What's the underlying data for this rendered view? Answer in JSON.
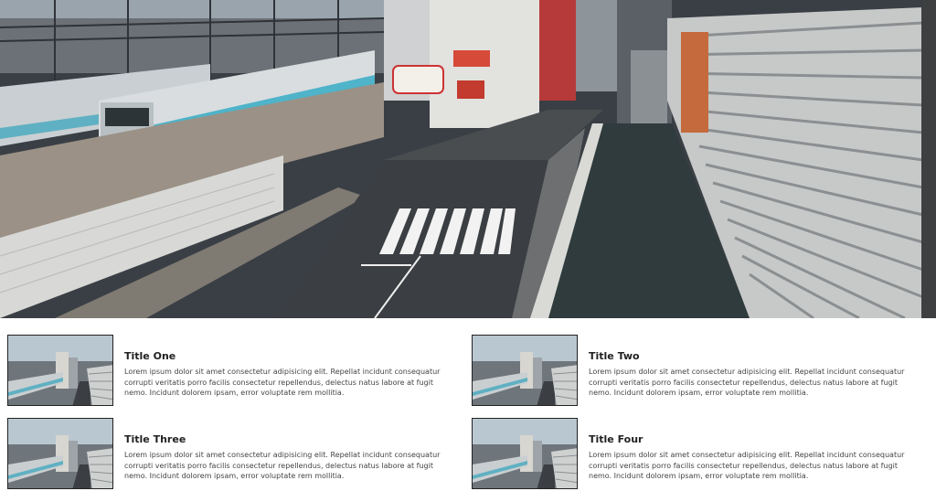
{
  "hero": {
    "image_icon": "city-street-photo"
  },
  "cards": [
    {
      "title": "Title One",
      "body": "Lorem ipsum dolor sit amet consectetur adipisicing elit. Repellat incidunt consequatur corrupti veritatis porro facilis consectetur repellendus, delectus natus labore at fugit nemo. Incidunt dolorem ipsam, error voluptate rem mollitia."
    },
    {
      "title": "Title Two",
      "body": "Lorem ipsum dolor sit amet consectetur adipisicing elit. Repellat incidunt consequatur corrupti veritatis porro facilis consectetur repellendus, delectus natus labore at fugit nemo. Incidunt dolorem ipsam, error voluptate rem mollitia."
    },
    {
      "title": "Title Three",
      "body": "Lorem ipsum dolor sit amet consectetur adipisicing elit. Repellat incidunt consequatur corrupti veritatis porro facilis consectetur repellendus, delectus natus labore at fugit nemo. Incidunt dolorem ipsam, error voluptate rem mollitia."
    },
    {
      "title": "Title Four",
      "body": "Lorem ipsum dolor sit amet consectetur adipisicing elit. Repellat incidunt consequatur corrupti veritatis porro facilis consectetur repellendus, delectus natus labore at fugit nemo. Incidunt dolorem ipsam, error voluptate rem mollitia."
    }
  ],
  "colors": {
    "title": "#222222",
    "body": "#444444",
    "thumb_border": "#222222"
  }
}
